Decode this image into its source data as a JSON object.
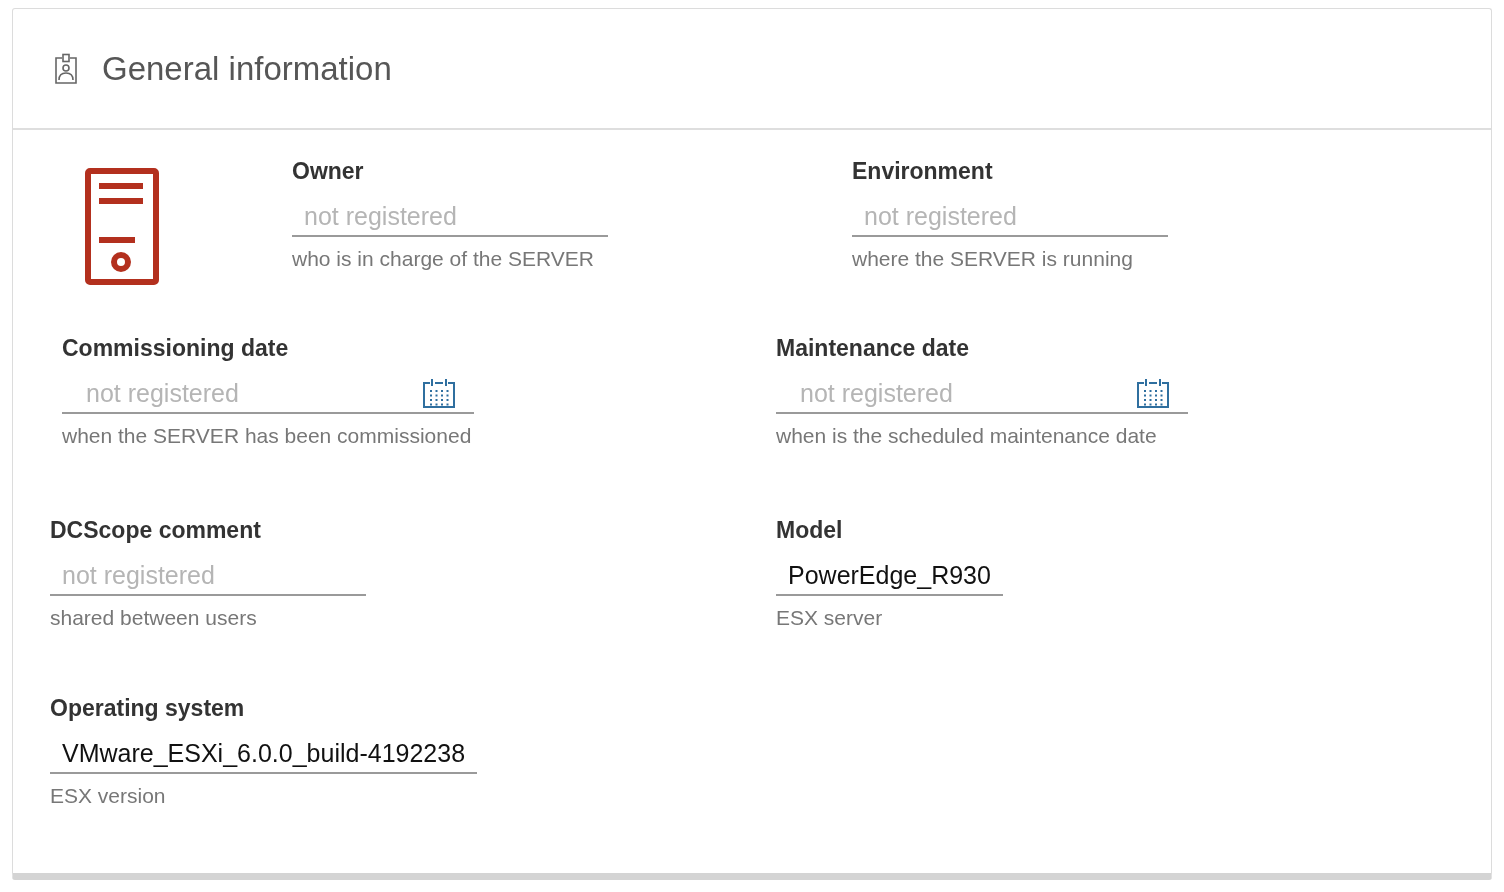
{
  "card": {
    "title": "General information"
  },
  "rows": [
    {
      "fields": [
        {
          "label": "Owner",
          "kind": "text",
          "placeholder": "not registered",
          "hint": "who is in charge of the SERVER"
        },
        {
          "label": "Environment",
          "kind": "text",
          "placeholder": "not registered",
          "hint": "where the SERVER is running"
        }
      ]
    },
    {
      "fields": [
        {
          "label": "Commissioning date",
          "kind": "date",
          "placeholder": "not registered",
          "hint": "when the SERVER has been commissioned"
        },
        {
          "label": "Maintenance date",
          "kind": "date",
          "placeholder": "not registered",
          "hint": "when is the scheduled maintenance date"
        }
      ]
    },
    {
      "fields": [
        {
          "label": "DCScope comment",
          "kind": "text",
          "placeholder": "not registered",
          "hint": "shared between users"
        },
        {
          "label": "Model",
          "kind": "text",
          "value": "PowerEdge_R930",
          "hint": "ESX server"
        }
      ]
    },
    {
      "fields": [
        {
          "label": "Operating system",
          "kind": "text",
          "value": "VMware_ESXi_6.0.0_build-4192238",
          "hint": "ESX version"
        }
      ]
    }
  ]
}
